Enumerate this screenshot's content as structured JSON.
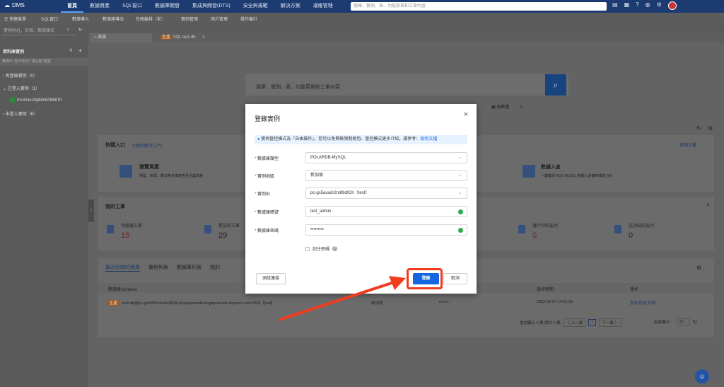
{
  "topnav": {
    "logo": "DMS",
    "menu": [
      "首頁",
      "數據資產",
      "SQL窗口",
      "數據庫開發",
      "集成與開發(DTS)",
      "安全與規範",
      "解決方案",
      "運維管理"
    ],
    "search_placeholder": "搜庫、實例、表、功能菜單和工單內容"
  },
  "subnav": {
    "items": [
      "☰ 快捷菜單",
      "SQL窗口",
      "數據導入",
      "數據庫導出",
      "任務編排（老）",
      "實例管理",
      "用戶管理",
      "操作審計"
    ]
  },
  "left": {
    "search_placeholder": "實例地址、名稱、數據庫名",
    "header": "資料庫實例",
    "filter_hint": "實例IP: 若不知道? 請在範\"範圍\"",
    "groups": [
      {
        "label": "› 免登錄實例（0）"
      },
      {
        "label": "⌄ 已登入實例（1）"
      },
      {
        "label": "rm-6nnu1ly8dn505687h"
      },
      {
        "label": "› 未登入實例（6）"
      }
    ]
  },
  "tabs": [
    {
      "label": "首頁"
    },
    {
      "badge": "生產",
      "label": "SQL test-db"
    }
  ],
  "main": {
    "hero_search_placeholder": "搜庫、實例、表、功能菜單和工單內容",
    "table_count_label": "表數量",
    "table_count": "0",
    "quick_entry": {
      "title": "快捷入口",
      "switch_link": "切換到新手入門",
      "doc_link": "說明文檔"
    },
    "entry_left": {
      "title": "瀏覽資產",
      "desc": "類型、來源、關日等多維度查看企業資產"
    },
    "entry_right": {
      "title": "數據入倉",
      "desc": "一鍵實現 RDS-MySQL 數據入倉實時報表分析"
    },
    "my_tickets": {
      "title": "我的工單",
      "cards": [
        {
          "label": "待處理工單",
          "value": "15"
        },
        {
          "label": "提交的工單",
          "value": "29"
        },
        {
          "label": "進行中的迭代",
          "value": "0"
        },
        {
          "label": "已完結的迭代",
          "value": "0"
        }
      ]
    },
    "asset_tabs": [
      "最近訪問的資產",
      "實例列表",
      "數據庫列表",
      "我的"
    ],
    "table": {
      "headers": [
        "數據庫/schema",
        "操作時間",
        "操作"
      ],
      "row": {
        "badge": "生產",
        "schema": "test-db@pc-gs5095orks6n340pl.mysql.polardb.singapore.rds.aliyuncs.com:3306【test】",
        "region": "新加坡",
        "user": "emm...",
        "time": "2022-06-24 14:21:02",
        "ops": "查詢 性能 詳情"
      }
    },
    "pager": {
      "text": "當前顯示 1 條 總共 1 條",
      "prev": "〈 上一頁",
      "page": "1",
      "next": "下一頁 〉",
      "per_page_label": "每頁顯示：",
      "per_page": "10"
    }
  },
  "modal": {
    "title": "登錄實例",
    "info": "實例管控模式為「自由操作」，您可以免費無限制使用。管控模式更多介紹，請參考：",
    "info_link": "說明文檔",
    "fields": [
      {
        "label": "數據庫類型",
        "value": "POLARDB-MySQL"
      },
      {
        "label": "實例地區",
        "value": "新加坡"
      },
      {
        "label": "實例ID",
        "value": "pc-gs5auudr2m89d02lr（test）"
      },
      {
        "label": "數據庫賬號",
        "value": "test_admin"
      },
      {
        "label": "數據庫密碼",
        "value": "•••••••••"
      }
    ],
    "remember": "記住密碼",
    "test_btn": "測試連接",
    "login_btn": "登錄",
    "cancel_btn": "取消"
  }
}
